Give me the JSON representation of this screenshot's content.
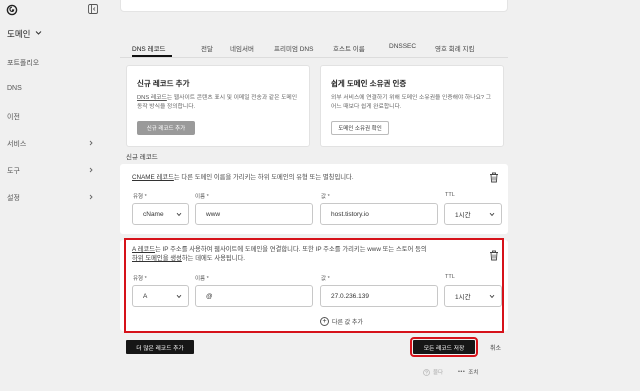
{
  "sidebar": {
    "domain_label": "도메인",
    "items": [
      {
        "label": "포트폴리오"
      },
      {
        "label": "DNS"
      },
      {
        "label": "이전"
      },
      {
        "label": "서비스"
      },
      {
        "label": "도구"
      },
      {
        "label": "설정"
      }
    ]
  },
  "tabs": [
    {
      "label": "DNS 레코드"
    },
    {
      "label": "전달"
    },
    {
      "label": "네임서버"
    },
    {
      "label": "프리미엄 DNS"
    },
    {
      "label": "호스트 이름"
    },
    {
      "label": "DNSSEC"
    },
    {
      "label": "영호 회례 지킴"
    }
  ],
  "add_record_card": {
    "title": "신규 레코드 추가",
    "desc_link": "DNS 레코드",
    "desc_rest": "는 웹사이트 콘텐츠 표시 및 이메일 전송과 같은 도메인 동작 방식을 정의합니다.",
    "button": "신규 레코드 추가"
  },
  "verify_card": {
    "title": "쉽게 도메인 소유권 인증",
    "desc": "외부 서비스에 연결하기 위해 도메인 소유권을 인증해야 하나요? 그 어느 때보다 쉽게 완료합니다.",
    "button": "도메인 소유권 확인"
  },
  "section_label": "신규 레코드",
  "cname_record": {
    "desc_link": "CNAME 레코드",
    "desc_rest": "는 다른 도메인 이름을 가리키는 하위 도메인의 유형 또는 별칭입니다.",
    "type_label": "유형 *",
    "type_value": "cName",
    "name_label": "이름 *",
    "name_value": "www",
    "value_label": "값 *",
    "value_value": "host.tistory.io",
    "ttl_label": "TTL",
    "ttl_value": "1시간"
  },
  "a_record": {
    "desc_link": "A 레코드",
    "desc_mid": "는 IP 주소를 사용하여 웹사이트에 도메인을 연결합니다. 또한 IP 주소를 가리키는 www 또는 스토어 등의",
    "desc_link2": "하위 도메인을 생성",
    "desc_rest": "하는 데에도 사용됩니다.",
    "type_label": "유형 *",
    "type_value": "A",
    "name_label": "이름 *",
    "name_value": "@",
    "value_label": "값 *",
    "value_value": "27.0.236.139",
    "ttl_label": "TTL",
    "ttl_value": "1시간",
    "add_value": "다른 값 추가"
  },
  "actions": {
    "more_records": "더 많은 레코드 추가",
    "save_all": "모든 레코드 저장",
    "cancel": "취소"
  },
  "footer": {
    "help": "물다",
    "more": "조치"
  }
}
